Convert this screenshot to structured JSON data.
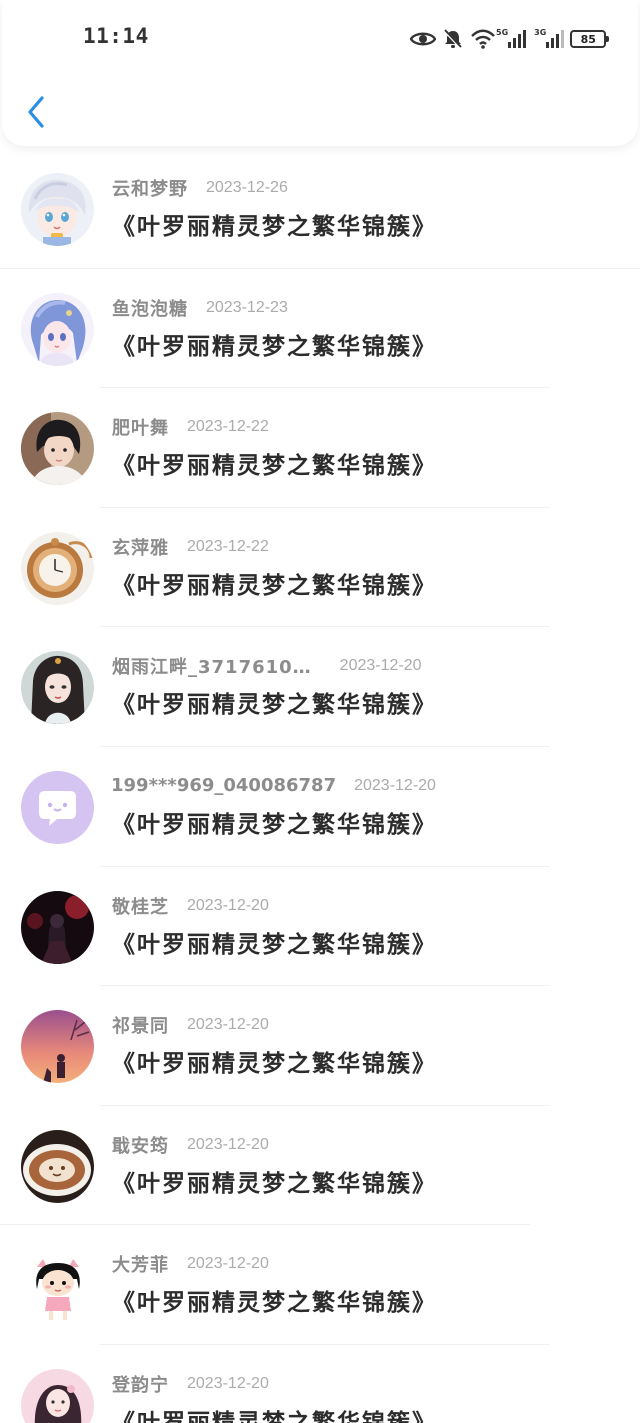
{
  "status_bar": {
    "time": "11:14",
    "net1_label": "5G",
    "net2_label": "3G",
    "battery": "85"
  },
  "colors": {
    "accent": "#2b8fe6",
    "title_text": "#2c2c2c",
    "name_text": "#8c8c8c",
    "date_text": "#ababab"
  },
  "list": {
    "items": [
      {
        "name": "云和梦野",
        "date": "2023-12-26",
        "title": "《叶罗丽精灵梦之繁华锦簇》",
        "avatar_icon": "anime-boy-avatar"
      },
      {
        "name": "鱼泡泡糖",
        "date": "2023-12-23",
        "title": "《叶罗丽精灵梦之繁华锦簇》",
        "avatar_icon": "anime-girl-blue-avatar"
      },
      {
        "name": "肥叶舞",
        "date": "2023-12-22",
        "title": "《叶罗丽精灵梦之繁华锦簇》",
        "avatar_icon": "child-photo-avatar"
      },
      {
        "name": "玄萍雅",
        "date": "2023-12-22",
        "title": "《叶罗丽精灵梦之繁华锦簇》",
        "avatar_icon": "pocket-watch-avatar"
      },
      {
        "name": "烟雨江畔_3717610…",
        "date": "2023-12-20",
        "title": "《叶罗丽精灵梦之繁华锦簇》",
        "avatar_icon": "ancient-beauty-avatar"
      },
      {
        "name": "199***969_040086787",
        "date": "2023-12-20",
        "title": "《叶罗丽精灵梦之繁华锦簇》",
        "avatar_icon": "chat-bubble-avatar"
      },
      {
        "name": "敬桂芝",
        "date": "2023-12-20",
        "title": "《叶罗丽精灵梦之繁华锦簇》",
        "avatar_icon": "dark-figure-avatar"
      },
      {
        "name": "祁景同",
        "date": "2023-12-20",
        "title": "《叶罗丽精灵梦之繁华锦簇》",
        "avatar_icon": "sunset-figure-avatar"
      },
      {
        "name": "戢安筠",
        "date": "2023-12-20",
        "title": "《叶罗丽精灵梦之繁华锦簇》",
        "avatar_icon": "latte-art-avatar"
      },
      {
        "name": "大芳菲",
        "date": "2023-12-20",
        "title": "《叶罗丽精灵梦之繁华锦簇》",
        "avatar_icon": "cartoon-girl-avatar"
      },
      {
        "name": "登韵宁",
        "date": "2023-12-20",
        "title": "《叶罗丽精灵梦之繁华锦簇》",
        "avatar_icon": "pink-dress-avatar"
      }
    ]
  }
}
